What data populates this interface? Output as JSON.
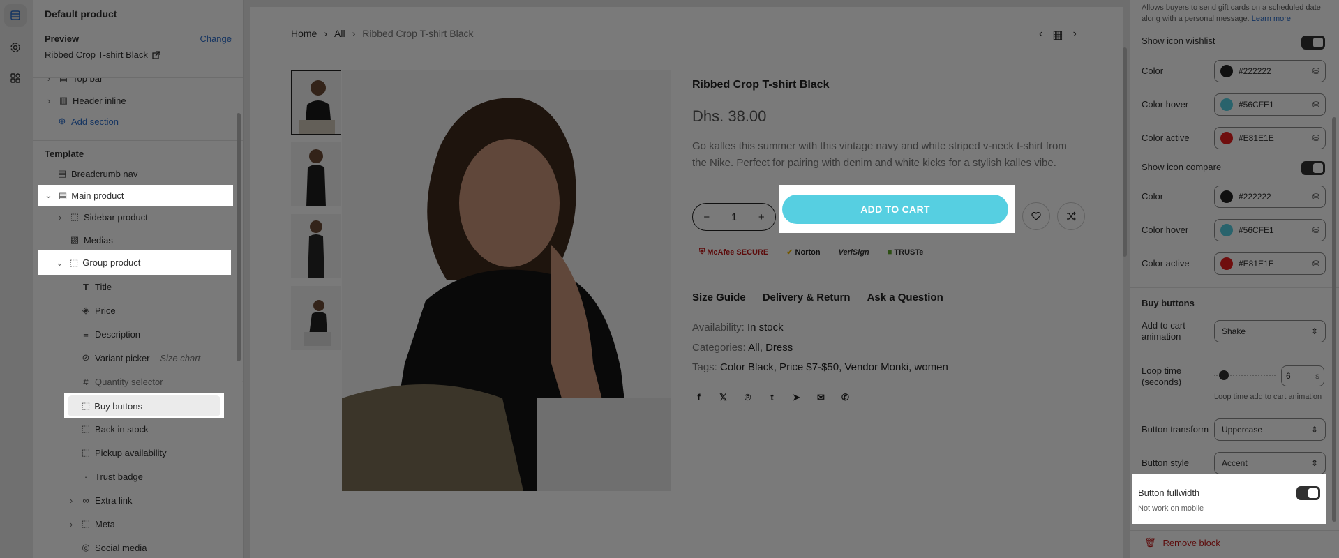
{
  "rail": {
    "icons": [
      "sections-icon",
      "gear-icon",
      "apps-icon"
    ]
  },
  "sidebar": {
    "title": "Default product",
    "preview_label": "Preview",
    "change_label": "Change",
    "product_name": "Ribbed Crop T-shirt Black",
    "header_items": [
      {
        "label": "Top bar"
      },
      {
        "label": "Header inline"
      }
    ],
    "add_section": "Add section",
    "template_label": "Template",
    "items": [
      {
        "label": "Breadcrumb nav"
      },
      {
        "label": "Main product"
      },
      {
        "label": "Sidebar product"
      },
      {
        "label": "Medias"
      },
      {
        "label": "Group product"
      },
      {
        "label": "Title"
      },
      {
        "label": "Price"
      },
      {
        "label": "Description"
      },
      {
        "label": "Variant picker",
        "note": "– Size chart"
      },
      {
        "label": "Quantity selector"
      },
      {
        "label": "Buy buttons"
      },
      {
        "label": "Back in stock"
      },
      {
        "label": "Pickup availability"
      },
      {
        "label": "Trust badge"
      },
      {
        "label": "Extra link"
      },
      {
        "label": "Meta"
      },
      {
        "label": "Social media"
      }
    ]
  },
  "preview": {
    "breadcrumb": [
      "Home",
      "All",
      "Ribbed Crop T-shirt Black"
    ],
    "product": {
      "title": "Ribbed Crop T-shirt Black",
      "price": "Dhs. 38.00",
      "description": "Go kalles this summer with this vintage navy and white striped v-neck t-shirt from the Nike. Perfect for pairing with denim and white kicks for a stylish kalles vibe.",
      "quantity": "1",
      "add_to_cart": "ADD TO CART",
      "trust_badges": [
        "McAfee SECURE",
        "Norton",
        "VeriSign",
        "TRUSTe"
      ],
      "tabs": [
        "Size Guide",
        "Delivery & Return",
        "Ask a Question"
      ],
      "availability_label": "Availability:",
      "availability_value": "In stock",
      "categories_label": "Categories:",
      "categories_value": "All, Dress",
      "tags_label": "Tags:",
      "tags_value": "Color Black, Price $7-$50, Vendor Monki, women",
      "share_icons": [
        "facebook-icon",
        "x-icon",
        "pinterest-icon",
        "tumblr-icon",
        "telegram-icon",
        "email-icon",
        "whatsapp-icon"
      ]
    }
  },
  "settings": {
    "gift_text": "Allows buyers to send gift cards on a scheduled date along with a personal message.",
    "learn_more": "Learn more",
    "wishlist": {
      "label": "Show icon wishlist",
      "color_label": "Color",
      "color": "#222222",
      "hover_label": "Color hover",
      "hover": "#56CFE1",
      "active_label": "Color active",
      "active": "#E81E1E"
    },
    "compare": {
      "label": "Show icon compare",
      "color_label": "Color",
      "color": "#222222",
      "hover_label": "Color hover",
      "hover": "#56CFE1",
      "active_label": "Color active",
      "active": "#E81E1E"
    },
    "buy_buttons_heading": "Buy buttons",
    "animation_label": "Add to cart animation",
    "animation_value": "Shake",
    "loop_label": "Loop time (seconds)",
    "loop_value": "6",
    "loop_unit": "s",
    "loop_level": 0.1,
    "loop_help": "Loop time add to cart animation",
    "transform_label": "Button transform",
    "transform_value": "Uppercase",
    "style_label": "Button style",
    "style_value": "Accent",
    "fullwidth_label": "Button fullwidth",
    "fullwidth_help": "Not work on mobile",
    "remove_block": "Remove block"
  }
}
